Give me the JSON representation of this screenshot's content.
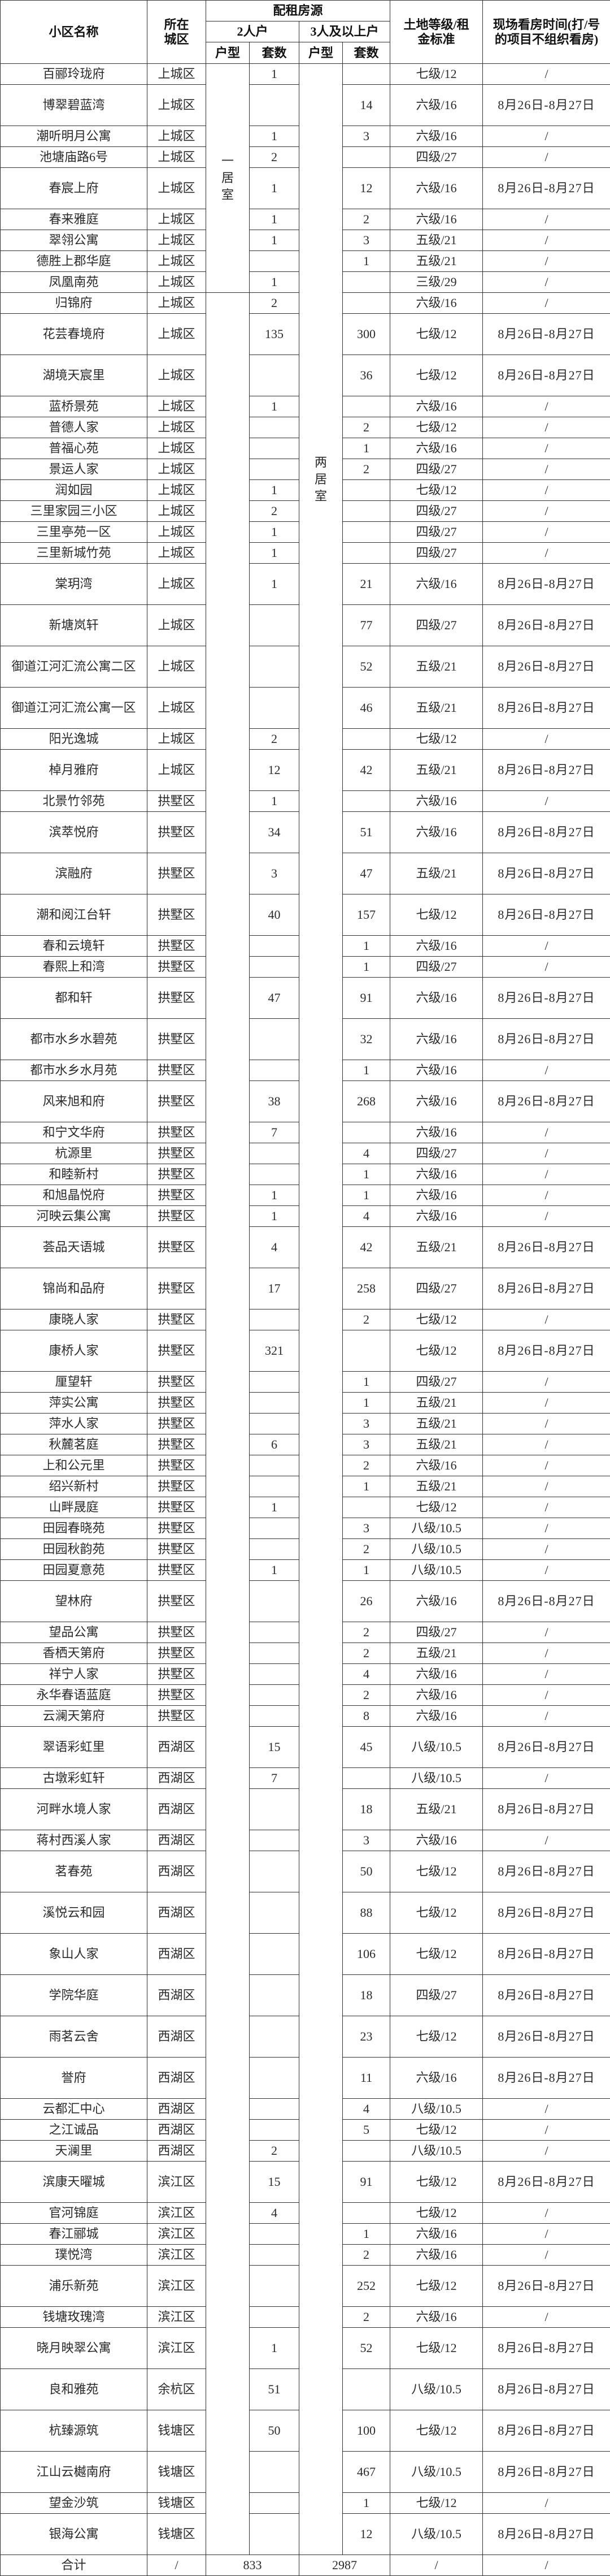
{
  "header": {
    "name": "小区名称",
    "district": "所在城区",
    "source": "配租房源",
    "two": "2人户",
    "three": "3人及以上户",
    "type": "户型",
    "count": "套数",
    "land": "土地等级/租金标准",
    "viewing": "现场看房时间(打/号的项目不组织看房)"
  },
  "unit_types": {
    "one_bedroom": "一居室",
    "two_bedroom": "两居室"
  },
  "rows": [
    {
      "name": "百郦玲珑府",
      "district": "上城区",
      "two": "1",
      "three": "",
      "grade": "七级/12",
      "time": "/"
    },
    {
      "name": "博翠碧蓝湾",
      "district": "上城区",
      "two": "",
      "three": "14",
      "grade": "六级/16",
      "time": "8月26日-8月27日"
    },
    {
      "name": "潮听明月公寓",
      "district": "上城区",
      "two": "1",
      "three": "3",
      "grade": "六级/16",
      "time": "/"
    },
    {
      "name": "池塘庙路6号",
      "district": "上城区",
      "two": "2",
      "three": "",
      "grade": "四级/27",
      "time": "/"
    },
    {
      "name": "春宸上府",
      "district": "上城区",
      "two": "1",
      "three": "12",
      "grade": "六级/16",
      "time": "8月26日-8月27日"
    },
    {
      "name": "春来雅庭",
      "district": "上城区",
      "two": "1",
      "three": "2",
      "grade": "六级/16",
      "time": "/"
    },
    {
      "name": "翠翎公寓",
      "district": "上城区",
      "two": "1",
      "three": "3",
      "grade": "五级/21",
      "time": "/"
    },
    {
      "name": "德胜上郡华庭",
      "district": "上城区",
      "two": "",
      "three": "1",
      "grade": "五级/21",
      "time": "/"
    },
    {
      "name": "凤凰南苑",
      "district": "上城区",
      "two": "1",
      "three": "",
      "grade": "三级/29",
      "time": "/"
    },
    {
      "name": "归锦府",
      "district": "上城区",
      "two": "2",
      "three": "",
      "grade": "六级/16",
      "time": "/"
    },
    {
      "name": "花芸春境府",
      "district": "上城区",
      "two": "135",
      "three": "300",
      "grade": "七级/12",
      "time": "8月26日-8月27日"
    },
    {
      "name": "湖境天宸里",
      "district": "上城区",
      "two": "",
      "three": "36",
      "grade": "七级/12",
      "time": "8月26日-8月27日"
    },
    {
      "name": "蓝桥景苑",
      "district": "上城区",
      "two": "1",
      "three": "",
      "grade": "六级/16",
      "time": "/"
    },
    {
      "name": "普德人家",
      "district": "上城区",
      "two": "",
      "three": "2",
      "grade": "七级/12",
      "time": "/"
    },
    {
      "name": "普福心苑",
      "district": "上城区",
      "two": "",
      "three": "1",
      "grade": "六级/16",
      "time": "/"
    },
    {
      "name": "景运人家",
      "district": "上城区",
      "two": "",
      "three": "2",
      "grade": "四级/27",
      "time": "/"
    },
    {
      "name": "润如园",
      "district": "上城区",
      "two": "1",
      "three": "",
      "grade": "七级/12",
      "time": "/"
    },
    {
      "name": "三里家园三小区",
      "district": "上城区",
      "two": "2",
      "three": "",
      "grade": "四级/27",
      "time": "/"
    },
    {
      "name": "三里亭苑一区",
      "district": "上城区",
      "two": "1",
      "three": "",
      "grade": "四级/27",
      "time": "/"
    },
    {
      "name": "三里新城竹苑",
      "district": "上城区",
      "two": "1",
      "three": "",
      "grade": "四级/27",
      "time": "/"
    },
    {
      "name": "棠玥湾",
      "district": "上城区",
      "two": "1",
      "three": "21",
      "grade": "六级/16",
      "time": "8月26日-8月27日"
    },
    {
      "name": "新塘岚轩",
      "district": "上城区",
      "two": "",
      "three": "77",
      "grade": "四级/27",
      "time": "8月26日-8月27日"
    },
    {
      "name": "御道江河汇流公寓二区",
      "district": "上城区",
      "two": "",
      "three": "52",
      "grade": "五级/21",
      "time": "8月26日-8月27日"
    },
    {
      "name": "御道江河汇流公寓一区",
      "district": "上城区",
      "two": "",
      "three": "46",
      "grade": "五级/21",
      "time": "8月26日-8月27日"
    },
    {
      "name": "阳光逸城",
      "district": "上城区",
      "two": "2",
      "three": "",
      "grade": "七级/12",
      "time": "/"
    },
    {
      "name": "棹月雅府",
      "district": "上城区",
      "two": "12",
      "three": "42",
      "grade": "五级/21",
      "time": "8月26日-8月27日"
    },
    {
      "name": "北景竹邻苑",
      "district": "拱墅区",
      "two": "1",
      "three": "",
      "grade": "六级/16",
      "time": "/"
    },
    {
      "name": "滨萃悦府",
      "district": "拱墅区",
      "two": "34",
      "three": "51",
      "grade": "六级/16",
      "time": "8月26日-8月27日"
    },
    {
      "name": "滨融府",
      "district": "拱墅区",
      "two": "3",
      "three": "47",
      "grade": "五级/21",
      "time": "8月26日-8月27日"
    },
    {
      "name": "潮和阅江台轩",
      "district": "拱墅区",
      "two": "40",
      "three": "157",
      "grade": "七级/12",
      "time": "8月26日-8月27日"
    },
    {
      "name": "春和云境轩",
      "district": "拱墅区",
      "two": "",
      "three": "1",
      "grade": "六级/16",
      "time": "/"
    },
    {
      "name": "春熙上和湾",
      "district": "拱墅区",
      "two": "",
      "three": "1",
      "grade": "四级/27",
      "time": "/"
    },
    {
      "name": "都和轩",
      "district": "拱墅区",
      "two": "47",
      "three": "91",
      "grade": "六级/16",
      "time": "8月26日-8月27日"
    },
    {
      "name": "都市水乡水碧苑",
      "district": "拱墅区",
      "two": "",
      "three": "32",
      "grade": "六级/16",
      "time": "8月26日-8月27日"
    },
    {
      "name": "都市水乡水月苑",
      "district": "拱墅区",
      "two": "",
      "three": "1",
      "grade": "六级/16",
      "time": "/"
    },
    {
      "name": "风来旭和府",
      "district": "拱墅区",
      "two": "38",
      "three": "268",
      "grade": "六级/16",
      "time": "8月26日-8月27日"
    },
    {
      "name": "和宁文华府",
      "district": "拱墅区",
      "two": "7",
      "three": "",
      "grade": "六级/16",
      "time": "/"
    },
    {
      "name": "杭源里",
      "district": "拱墅区",
      "two": "",
      "three": "4",
      "grade": "四级/27",
      "time": "/"
    },
    {
      "name": "和睦新村",
      "district": "拱墅区",
      "two": "",
      "three": "1",
      "grade": "六级/16",
      "time": "/"
    },
    {
      "name": "和旭晶悦府",
      "district": "拱墅区",
      "two": "1",
      "three": "1",
      "grade": "六级/16",
      "time": "/"
    },
    {
      "name": "河映云集公寓",
      "district": "拱墅区",
      "two": "1",
      "three": "4",
      "grade": "六级/16",
      "time": "/"
    },
    {
      "name": "荟品天语城",
      "district": "拱墅区",
      "two": "4",
      "three": "42",
      "grade": "五级/21",
      "time": "8月26日-8月27日"
    },
    {
      "name": "锦尚和品府",
      "district": "拱墅区",
      "two": "17",
      "three": "258",
      "grade": "四级/27",
      "time": "8月26日-8月27日"
    },
    {
      "name": "康晓人家",
      "district": "拱墅区",
      "two": "",
      "three": "2",
      "grade": "七级/12",
      "time": "/"
    },
    {
      "name": "康桥人家",
      "district": "拱墅区",
      "two": "321",
      "three": "",
      "grade": "七级/12",
      "time": "8月26日-8月27日"
    },
    {
      "name": "厘望轩",
      "district": "拱墅区",
      "two": "",
      "three": "1",
      "grade": "四级/27",
      "time": "/"
    },
    {
      "name": "萍实公寓",
      "district": "拱墅区",
      "two": "",
      "three": "1",
      "grade": "五级/21",
      "time": "/"
    },
    {
      "name": "萍水人家",
      "district": "拱墅区",
      "two": "",
      "three": "3",
      "grade": "五级/21",
      "time": "/"
    },
    {
      "name": "秋麓茗庭",
      "district": "拱墅区",
      "two": "6",
      "three": "3",
      "grade": "五级/21",
      "time": "/"
    },
    {
      "name": "上和公元里",
      "district": "拱墅区",
      "two": "",
      "three": "2",
      "grade": "六级/16",
      "time": "/"
    },
    {
      "name": "绍兴新村",
      "district": "拱墅区",
      "two": "",
      "three": "1",
      "grade": "五级/21",
      "time": "/"
    },
    {
      "name": "山畔晟庭",
      "district": "拱墅区",
      "two": "1",
      "three": "",
      "grade": "七级/12",
      "time": "/"
    },
    {
      "name": "田园春晓苑",
      "district": "拱墅区",
      "two": "",
      "three": "3",
      "grade": "八级/10.5",
      "time": "/"
    },
    {
      "name": "田园秋韵苑",
      "district": "拱墅区",
      "two": "",
      "three": "2",
      "grade": "八级/10.5",
      "time": "/"
    },
    {
      "name": "田园夏意苑",
      "district": "拱墅区",
      "two": "1",
      "three": "1",
      "grade": "八级/10.5",
      "time": "/"
    },
    {
      "name": "望林府",
      "district": "拱墅区",
      "two": "",
      "three": "26",
      "grade": "六级/16",
      "time": "8月26日-8月27日"
    },
    {
      "name": "望品公寓",
      "district": "拱墅区",
      "two": "",
      "three": "2",
      "grade": "四级/27",
      "time": "/"
    },
    {
      "name": "香栖天第府",
      "district": "拱墅区",
      "two": "",
      "three": "2",
      "grade": "五级/21",
      "time": "/"
    },
    {
      "name": "祥宁人家",
      "district": "拱墅区",
      "two": "",
      "three": "4",
      "grade": "六级/16",
      "time": "/"
    },
    {
      "name": "永华春语蓝庭",
      "district": "拱墅区",
      "two": "",
      "three": "2",
      "grade": "六级/16",
      "time": "/"
    },
    {
      "name": "云澜天第府",
      "district": "拱墅区",
      "two": "",
      "three": "8",
      "grade": "六级/16",
      "time": "/"
    },
    {
      "name": "翠语彩虹里",
      "district": "西湖区",
      "two": "15",
      "three": "45",
      "grade": "八级/10.5",
      "time": "8月26日-8月27日"
    },
    {
      "name": "古墩彩虹轩",
      "district": "西湖区",
      "two": "7",
      "three": "",
      "grade": "八级/10.5",
      "time": "/"
    },
    {
      "name": "河畔水境人家",
      "district": "西湖区",
      "two": "",
      "three": "18",
      "grade": "五级/21",
      "time": "8月26日-8月27日"
    },
    {
      "name": "蒋村西溪人家",
      "district": "西湖区",
      "two": "",
      "three": "3",
      "grade": "六级/16",
      "time": "/"
    },
    {
      "name": "茗春苑",
      "district": "西湖区",
      "two": "",
      "three": "50",
      "grade": "七级/12",
      "time": "8月26日-8月27日"
    },
    {
      "name": "溪悦云和园",
      "district": "西湖区",
      "two": "",
      "three": "88",
      "grade": "七级/12",
      "time": "8月26日-8月27日"
    },
    {
      "name": "象山人家",
      "district": "西湖区",
      "two": "",
      "three": "106",
      "grade": "七级/12",
      "time": "8月26日-8月27日"
    },
    {
      "name": "学院华庭",
      "district": "西湖区",
      "two": "",
      "three": "18",
      "grade": "四级/27",
      "time": "8月26日-8月27日"
    },
    {
      "name": "雨茗云舍",
      "district": "西湖区",
      "two": "",
      "three": "23",
      "grade": "七级/12",
      "time": "8月26日-8月27日"
    },
    {
      "name": "誉府",
      "district": "西湖区",
      "two": "",
      "three": "11",
      "grade": "六级/16",
      "time": "8月26日-8月27日"
    },
    {
      "name": "云都汇中心",
      "district": "西湖区",
      "two": "",
      "three": "4",
      "grade": "八级/10.5",
      "time": "/"
    },
    {
      "name": "之江诚品",
      "district": "西湖区",
      "two": "",
      "three": "5",
      "grade": "七级/12",
      "time": "/"
    },
    {
      "name": "天澜里",
      "district": "西湖区",
      "two": "2",
      "three": "",
      "grade": "八级/10.5",
      "time": "/"
    },
    {
      "name": "滨康天曜城",
      "district": "滨江区",
      "two": "15",
      "three": "91",
      "grade": "七级/12",
      "time": "8月26日-8月27日"
    },
    {
      "name": "官河锦庭",
      "district": "滨江区",
      "two": "4",
      "three": "",
      "grade": "七级/12",
      "time": "/"
    },
    {
      "name": "春江郦城",
      "district": "滨江区",
      "two": "",
      "three": "1",
      "grade": "六级/16",
      "time": "/"
    },
    {
      "name": "璞悦湾",
      "district": "滨江区",
      "two": "",
      "three": "2",
      "grade": "六级/16",
      "time": "/"
    },
    {
      "name": "浦乐新苑",
      "district": "滨江区",
      "two": "",
      "three": "252",
      "grade": "七级/12",
      "time": "8月26日-8月27日"
    },
    {
      "name": "钱塘玫瑰湾",
      "district": "滨江区",
      "two": "",
      "three": "2",
      "grade": "六级/16",
      "time": "/"
    },
    {
      "name": "晓月映翠公寓",
      "district": "滨江区",
      "two": "1",
      "three": "52",
      "grade": "七级/12",
      "time": "8月26日-8月27日"
    },
    {
      "name": "良和雅苑",
      "district": "余杭区",
      "two": "51",
      "three": "",
      "grade": "八级/10.5",
      "time": "8月26日-8月27日"
    },
    {
      "name": "杭臻源筑",
      "district": "钱塘区",
      "two": "50",
      "three": "100",
      "grade": "七级/12",
      "time": "8月26日-8月27日"
    },
    {
      "name": "江山云樾南府",
      "district": "钱塘区",
      "two": "",
      "three": "467",
      "grade": "八级/10.5",
      "time": "8月26日-8月27日"
    },
    {
      "name": "望金沙筑",
      "district": "钱塘区",
      "two": "",
      "three": "1",
      "grade": "七级/12",
      "time": "/"
    },
    {
      "name": "银海公寓",
      "district": "钱塘区",
      "two": "",
      "three": "12",
      "grade": "八级/10.5",
      "time": "8月26日-8月27日"
    }
  ],
  "total": {
    "label": "合计",
    "district": "/",
    "two": "833",
    "three": "2987",
    "grade": "/",
    "time": "/"
  }
}
